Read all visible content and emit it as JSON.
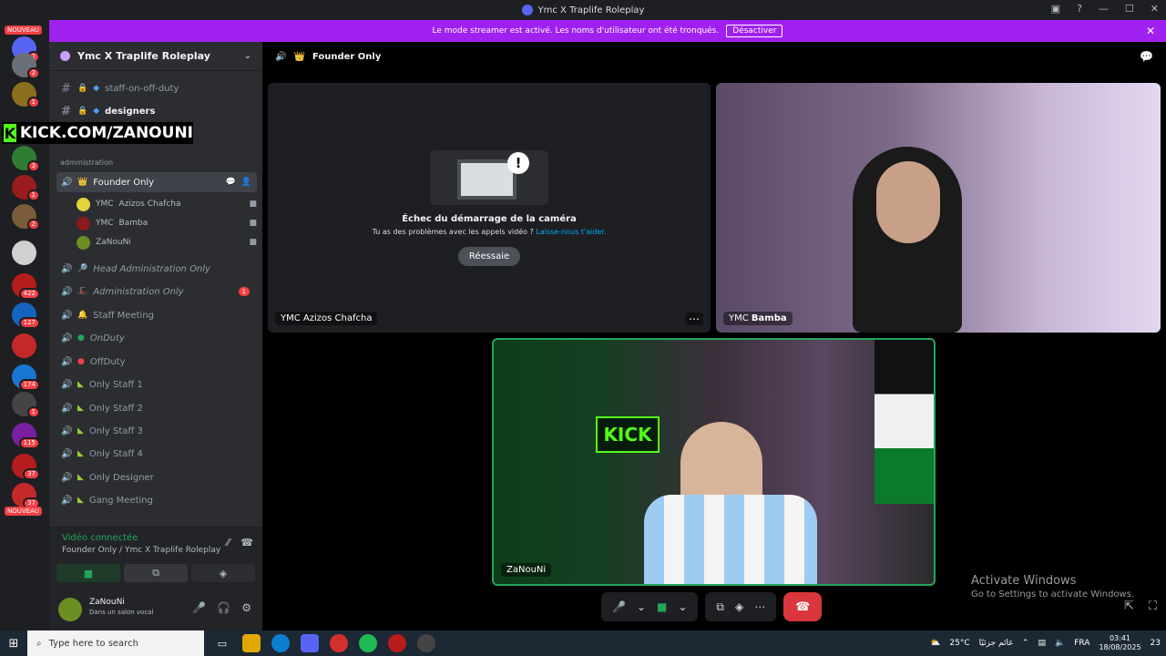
{
  "window": {
    "title": "Ymc X Traplife Roleplay"
  },
  "banner": {
    "text": "Le mode streamer est activé. Les noms d'utilisateur ont été tronqués.",
    "button": "Désactiver"
  },
  "servers": {
    "nouveau_top": "NOUVEAU",
    "nouveau_bottom": "NOUVEAU",
    "badges": [
      "2",
      "2",
      "1",
      "3",
      "1",
      "2",
      "422",
      "127",
      "174",
      "1",
      "115",
      "37",
      "37"
    ]
  },
  "overlay": {
    "letter": "K",
    "text": "KICK.COM/ZANOUNI"
  },
  "guild": {
    "name": "Ymc X Traplife Roleplay"
  },
  "channels": {
    "staff_on_off": "staff-on-off-duty",
    "designers": "designers",
    "category": "administration",
    "founder": "Founder Only",
    "users": [
      {
        "prefix": "YMC",
        "name": "Azizos Chafcha"
      },
      {
        "prefix": "YMC",
        "name": "Bamba"
      },
      {
        "prefix": "",
        "name": "ZaNouNi"
      }
    ],
    "voice": [
      {
        "name": "Head Administration Only",
        "badge": ""
      },
      {
        "name": "Administration Only",
        "badge": "1"
      },
      {
        "name": "Staff Meeting",
        "badge": ""
      },
      {
        "name": "OnDuty",
        "badge": ""
      },
      {
        "name": "OffDuty",
        "badge": ""
      },
      {
        "name": "Only Staff 1",
        "badge": ""
      },
      {
        "name": "Only Staff 2",
        "badge": ""
      },
      {
        "name": "Only Staff 3",
        "badge": ""
      },
      {
        "name": "Only Staff 4",
        "badge": ""
      },
      {
        "name": "Only Designer",
        "badge": ""
      },
      {
        "name": "Gang Meeting",
        "badge": ""
      }
    ]
  },
  "voice_panel": {
    "status": "Vidéo connectée",
    "location": "Founder Only / Ymc X Traplife Roleplay"
  },
  "user_panel": {
    "name": "ZaNouNi",
    "status": "Dans un salon vocal"
  },
  "main": {
    "channel": "Founder Only",
    "camera_fail": {
      "title": "Échec du démarrage de la caméra",
      "subtitle": "Tu as des problèmes avec les appels vidéo ?",
      "link": "Laisse-nous t'aider.",
      "retry": "Réessaie"
    },
    "tiles": [
      {
        "prefix": "YMC",
        "name": "Azizos Chafcha"
      },
      {
        "prefix": "YMC",
        "name": "Bamba"
      },
      {
        "prefix": "",
        "name": "ZaNouNi"
      }
    ],
    "stream_text": "KICK"
  },
  "watermark": {
    "line1": "Activate Windows",
    "line2": "Go to Settings to activate Windows."
  },
  "taskbar": {
    "search_placeholder": "Type here to search",
    "weather": "25°C",
    "weather_text": "غائم جزئيًا",
    "lang": "FRA",
    "time": "03:41",
    "date": "18/08/2025",
    "notif": "23"
  },
  "colors": {
    "accent": "#a020f0",
    "kick": "#53fc18",
    "green": "#23a55a",
    "end_call": "#da373c"
  }
}
